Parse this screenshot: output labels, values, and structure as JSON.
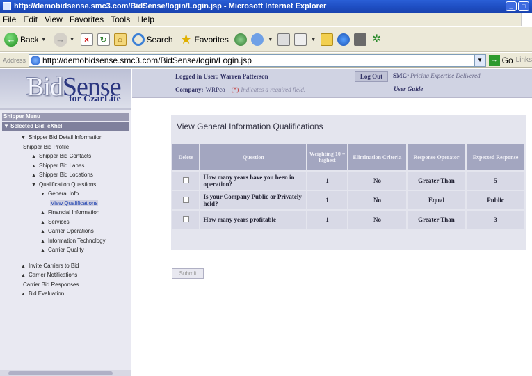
{
  "window": {
    "title": "http://demobidsense.smc3.com/BidSense/login/Login.jsp - Microsoft Internet Explorer"
  },
  "menu": [
    "File",
    "Edit",
    "View",
    "Favorites",
    "Tools",
    "Help"
  ],
  "toolbar": {
    "back": "Back",
    "search": "Search",
    "favorites": "Favorites"
  },
  "address": {
    "label": "Address",
    "url": "http://demobidsense.smc3.com/BidSense/login/Login.jsp",
    "go": "Go",
    "links": "Links"
  },
  "logo": {
    "name_part1": "Bid",
    "name_part2": "Sense",
    "tagline": "for CzarLite"
  },
  "header": {
    "logged_in_label": "Logged in User:",
    "logged_in_user": "Warren Patterson",
    "logout": "Log Out",
    "smc": "SMC³",
    "smc_tagline": "Pricing Expertise Delivered",
    "company_label": "Company:",
    "company_value": "WRPco",
    "required_marker": "(*)",
    "required_note": "Indicates a required field.",
    "user_guide": "User Guide"
  },
  "sidebar": {
    "menu_header": "Shipper Menu",
    "selected": "Selected Bid: eXhel",
    "items": [
      {
        "label": "Shipper Bid Detail Information",
        "arrow": "down"
      },
      {
        "label": "Shipper Bid Profile",
        "arrow": ""
      },
      {
        "label": "Shipper Bid Contacts",
        "arrow": "up"
      },
      {
        "label": "Shipper Bid Lanes",
        "arrow": "up"
      },
      {
        "label": "Shipper Bid Locations",
        "arrow": "up"
      },
      {
        "label": "Qualification Questions",
        "arrow": "down"
      },
      {
        "label": "General Info",
        "arrow": "down"
      },
      {
        "label": "View Qualifications",
        "arrow": ""
      },
      {
        "label": "Financial Information",
        "arrow": "up"
      },
      {
        "label": "Services",
        "arrow": "up"
      },
      {
        "label": "Carrier Operations",
        "arrow": "up"
      },
      {
        "label": "Information Technology",
        "arrow": "up"
      },
      {
        "label": "Carrier Quality",
        "arrow": "up"
      },
      {
        "label": "Invite Carriers to Bid",
        "arrow": "up"
      },
      {
        "label": "Carrier Notifications",
        "arrow": "up"
      },
      {
        "label": "Carrier Bid Responses",
        "arrow": ""
      },
      {
        "label": "Bid Evaluation",
        "arrow": "up"
      }
    ]
  },
  "main": {
    "title": "View General Information Qualifications",
    "columns": [
      "Delete",
      "Question",
      "Weighting 10 = highest",
      "Elimination Criteria",
      "Response Operator",
      "Expected Response"
    ],
    "rows": [
      {
        "question": "How many years have you been in operation?",
        "weighting": "1",
        "elimination": "No",
        "operator": "Greater Than",
        "expected": "5"
      },
      {
        "question": "Is your Company Public or Privately held?",
        "weighting": "1",
        "elimination": "No",
        "operator": "Equal",
        "expected": "Public"
      },
      {
        "question": "How many years profitable",
        "weighting": "1",
        "elimination": "No",
        "operator": "Greater Than",
        "expected": "3"
      }
    ],
    "submit": "Submit"
  }
}
